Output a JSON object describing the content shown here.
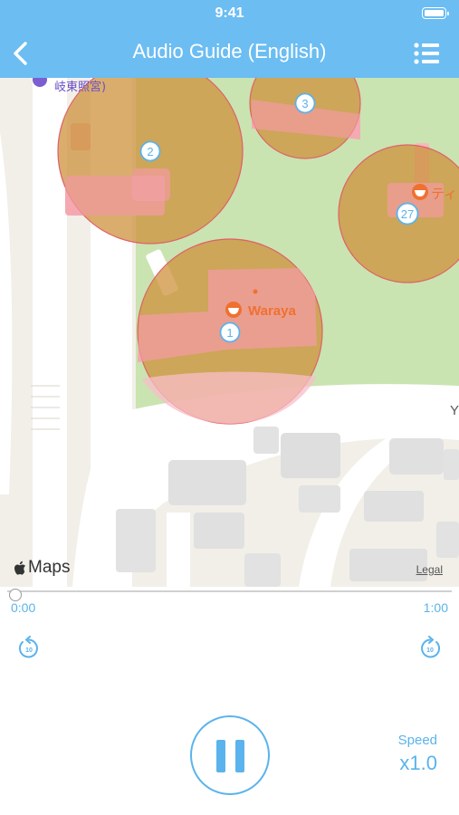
{
  "status_bar": {
    "time": "9:41"
  },
  "nav": {
    "title": "Audio Guide (English)"
  },
  "map": {
    "poi_top_label": "岐東照宮)",
    "poi_main_label": "Waraya",
    "poi_right_label": "ティ",
    "edge_label": "Y",
    "markers": [
      "1",
      "2",
      "3",
      "27"
    ],
    "attribution": "Maps",
    "legal": "Legal"
  },
  "player": {
    "progress": 0,
    "time_start": "0:00",
    "time_end": "1:00",
    "skip_seconds": "10",
    "speed_label": "Speed",
    "speed_value": "x1.0",
    "state": "playing"
  },
  "colors": {
    "bar": "#6bbdf2",
    "accent": "#5ab3ec",
    "marker_circle": "rgba(205,145,60,0.75)",
    "park": "#c9e4b0",
    "building": "#f4b9bd"
  },
  "icons": {
    "back": "chevron-left-icon",
    "menu": "list-icon",
    "skip_back": "rewind-10-icon",
    "skip_fwd": "forward-10-icon",
    "play_state": "pause-icon",
    "restaurant": "bowl-icon",
    "apple": "apple-logo-icon"
  }
}
